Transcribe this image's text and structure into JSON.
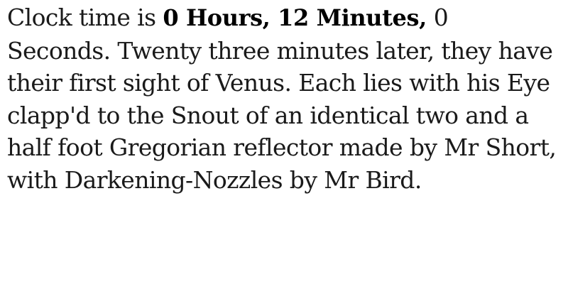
{
  "passage": {
    "intro": "Clock time is ",
    "highlight": "0 Hours, 12 Minutes,",
    "line1_tail": " 0",
    "line2": "Seconds. Twenty three minutes later, they have",
    "line3": "their first sight of Venus. Each lies with his Eye",
    "line4": "clapp'd to the Snout of an identical two and a",
    "line5": "half foot Gregorian reflector made by Mr Short,",
    "line6": "with Darkening-Nozzles by Mr Bird."
  }
}
